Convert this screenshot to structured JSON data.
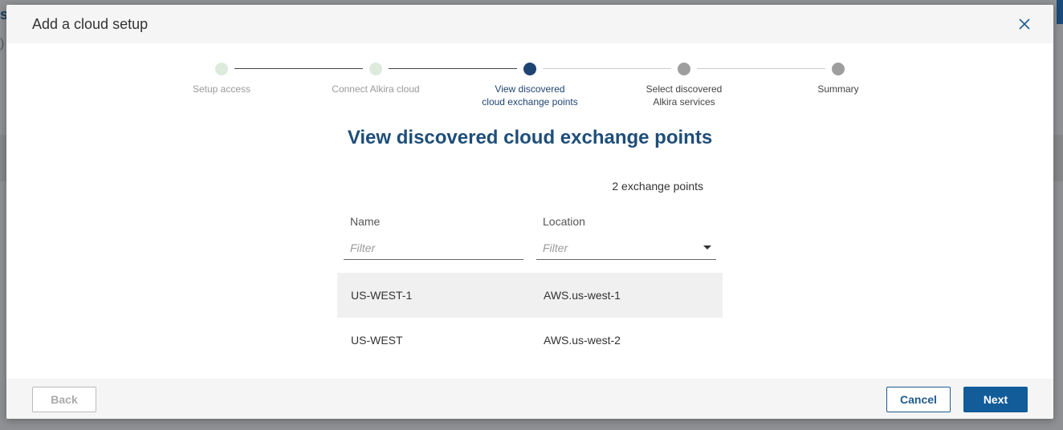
{
  "modal": {
    "title": "Add a cloud setup"
  },
  "stepper": {
    "steps": [
      {
        "label": "Setup access",
        "state": "done"
      },
      {
        "label": "Connect Alkira cloud",
        "state": "done"
      },
      {
        "label": "View discovered\ncloud exchange points",
        "state": "current"
      },
      {
        "label": "Select discovered\nAlkira services",
        "state": "future"
      },
      {
        "label": "Summary",
        "state": "future"
      }
    ]
  },
  "content": {
    "heading": "View discovered cloud exchange points",
    "count_label": "2 exchange points",
    "columns": {
      "name": {
        "header": "Name",
        "placeholder": "Filter"
      },
      "location": {
        "header": "Location",
        "placeholder": "Filter"
      }
    },
    "rows": [
      {
        "name": "US-WEST-1",
        "location": "AWS.us-west-1"
      },
      {
        "name": "US-WEST",
        "location": "AWS.us-west-2"
      }
    ]
  },
  "footer": {
    "back_label": "Back",
    "cancel_label": "Cancel",
    "next_label": "Next"
  },
  "colors": {
    "accent": "#1e4472",
    "heading": "#1f4e79",
    "primary_button": "#115c99",
    "done_step": "#dcebdc",
    "future_step": "#9e9e9e"
  },
  "icons": {
    "close": "close-icon",
    "dropdown": "caret-down-icon"
  }
}
